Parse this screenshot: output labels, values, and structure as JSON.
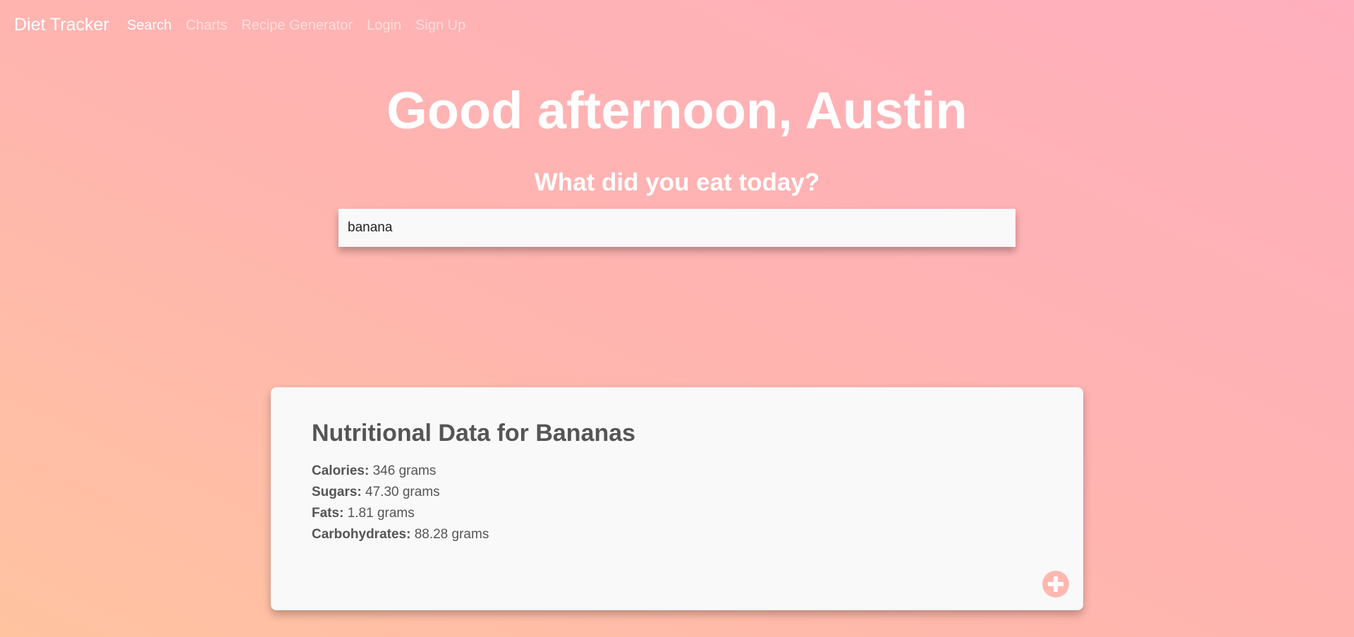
{
  "navbar": {
    "brand": "Diet Tracker",
    "links": [
      {
        "label": "Search",
        "active": true
      },
      {
        "label": "Charts",
        "active": false
      },
      {
        "label": "Recipe Generator",
        "active": false
      },
      {
        "label": "Login",
        "active": false
      },
      {
        "label": "Sign Up",
        "active": false
      }
    ]
  },
  "hero": {
    "greeting": "Good afternoon, Austin",
    "prompt": "What did you eat today?"
  },
  "search": {
    "value": "banana"
  },
  "result_card": {
    "title": "Nutritional Data for Bananas",
    "nutrients": [
      {
        "label": "Calories:",
        "value": "346 grams"
      },
      {
        "label": "Sugars:",
        "value": "47.30 grams"
      },
      {
        "label": "Fats:",
        "value": "1.81 grams"
      },
      {
        "label": "Carbohydrates:",
        "value": "88.28 grams"
      }
    ],
    "add_icon": "plus-circle-icon"
  },
  "colors": {
    "background_start": "#ffc3a0",
    "background_end": "#ffafbd",
    "card_background": "#f9f9fa",
    "text_dark": "#555555",
    "add_button": "#ffb8b0"
  }
}
